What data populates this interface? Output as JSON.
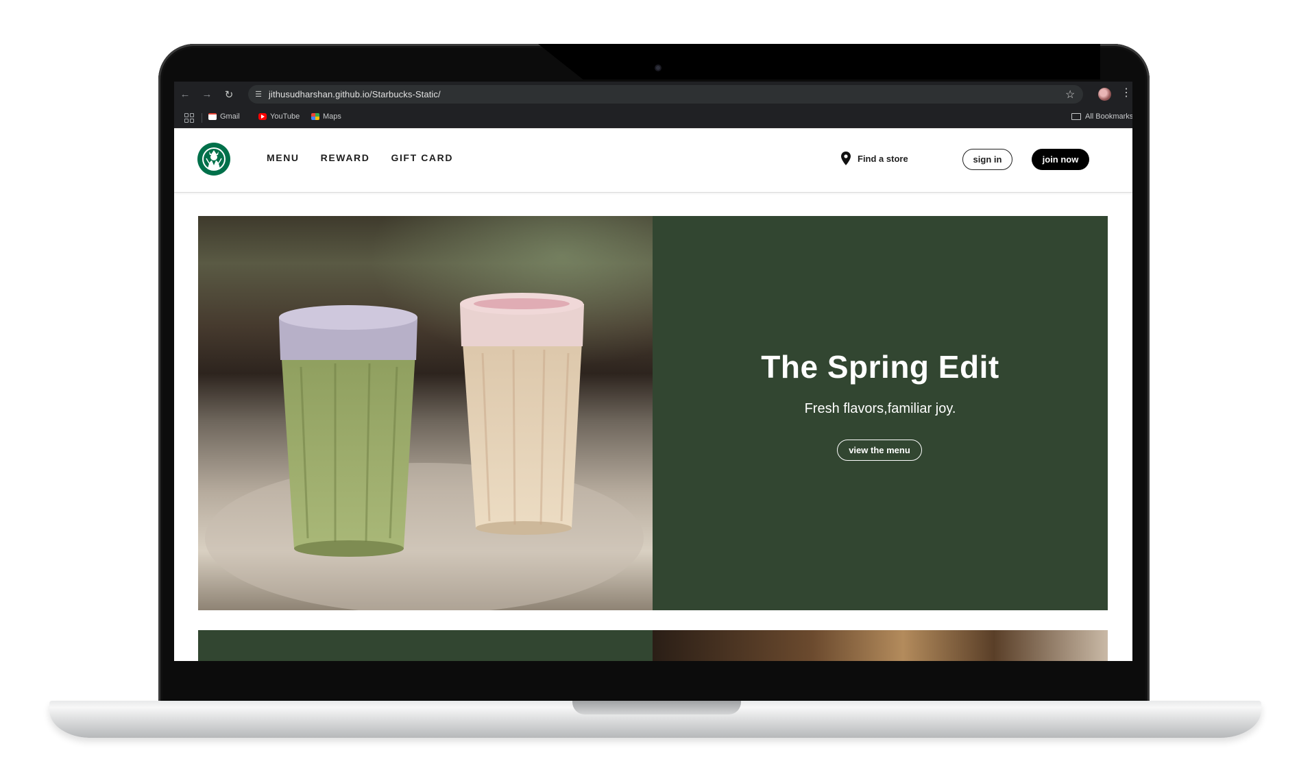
{
  "browser": {
    "url": "jithusudharshan.github.io/Starbucks-Static/",
    "bookmarks": [
      {
        "label": "Gmail",
        "icon": "gmail-icon"
      },
      {
        "label": "YouTube",
        "icon": "youtube-icon"
      },
      {
        "label": "Maps",
        "icon": "maps-icon"
      }
    ],
    "all_bookmarks_label": "All Bookmarks"
  },
  "header": {
    "nav": [
      "MENU",
      "REWARD",
      "GIFT CARD"
    ],
    "find_store_label": "Find a store",
    "sign_in_label": "sign in",
    "join_label": "join now"
  },
  "hero": {
    "title": "The Spring Edit",
    "subtitle": "Fresh flavors,familiar joy.",
    "button_label": "view the menu"
  },
  "colors": {
    "brand_green": "#324631",
    "logo_green": "#00704a",
    "browser_bg": "#202124"
  }
}
